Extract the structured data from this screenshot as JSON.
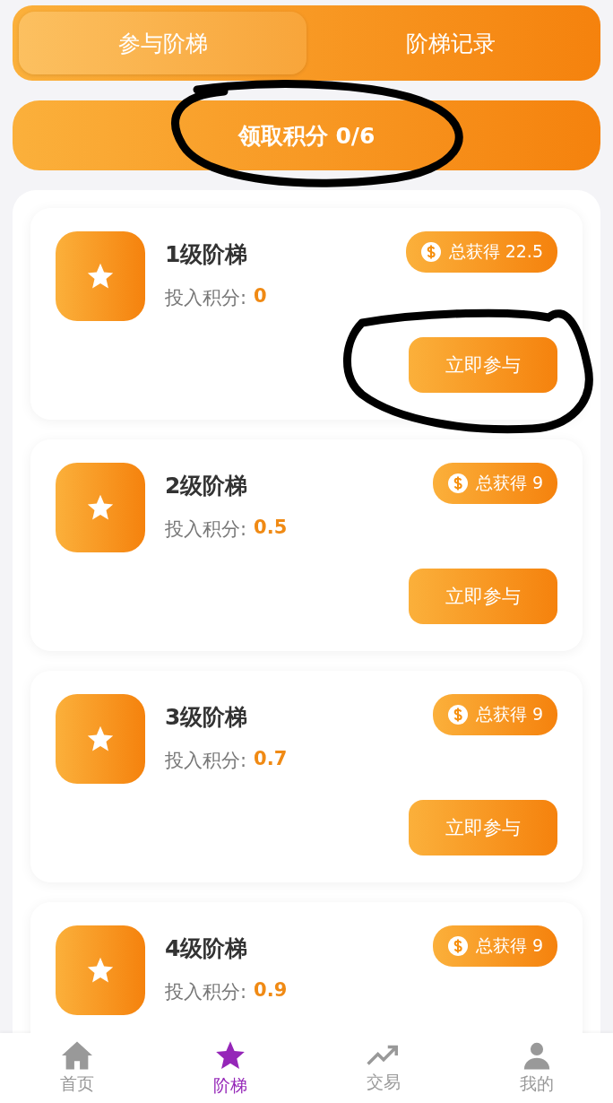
{
  "tabs": [
    {
      "label": "参与阶梯",
      "selected": true
    },
    {
      "label": "阶梯记录",
      "selected": false
    }
  ],
  "claim_button": {
    "label": "领取积分 0/6",
    "circled": true
  },
  "ladders": [
    {
      "title": "1级阶梯",
      "earned": "总获得 22.5",
      "input_label": "投入积分:",
      "input_value": "0",
      "button": "立即参与",
      "circled": true
    },
    {
      "title": "2级阶梯",
      "earned": "总获得 9",
      "input_label": "投入积分:",
      "input_value": "0.5",
      "button": "立即参与",
      "circled": false
    },
    {
      "title": "3级阶梯",
      "earned": "总获得 9",
      "input_label": "投入积分:",
      "input_value": "0.7",
      "button": "立即参与",
      "circled": false
    },
    {
      "title": "4级阶梯",
      "earned": "总获得 9",
      "input_label": "投入积分:",
      "input_value": "0.9",
      "circled": false
    }
  ],
  "bottom_nav": [
    {
      "label": "首页",
      "kind": "home",
      "selected": false
    },
    {
      "label": "阶梯",
      "kind": "star",
      "selected": true
    },
    {
      "label": "交易",
      "kind": "trend",
      "selected": false
    },
    {
      "label": "我的",
      "kind": "user",
      "selected": false
    }
  ]
}
